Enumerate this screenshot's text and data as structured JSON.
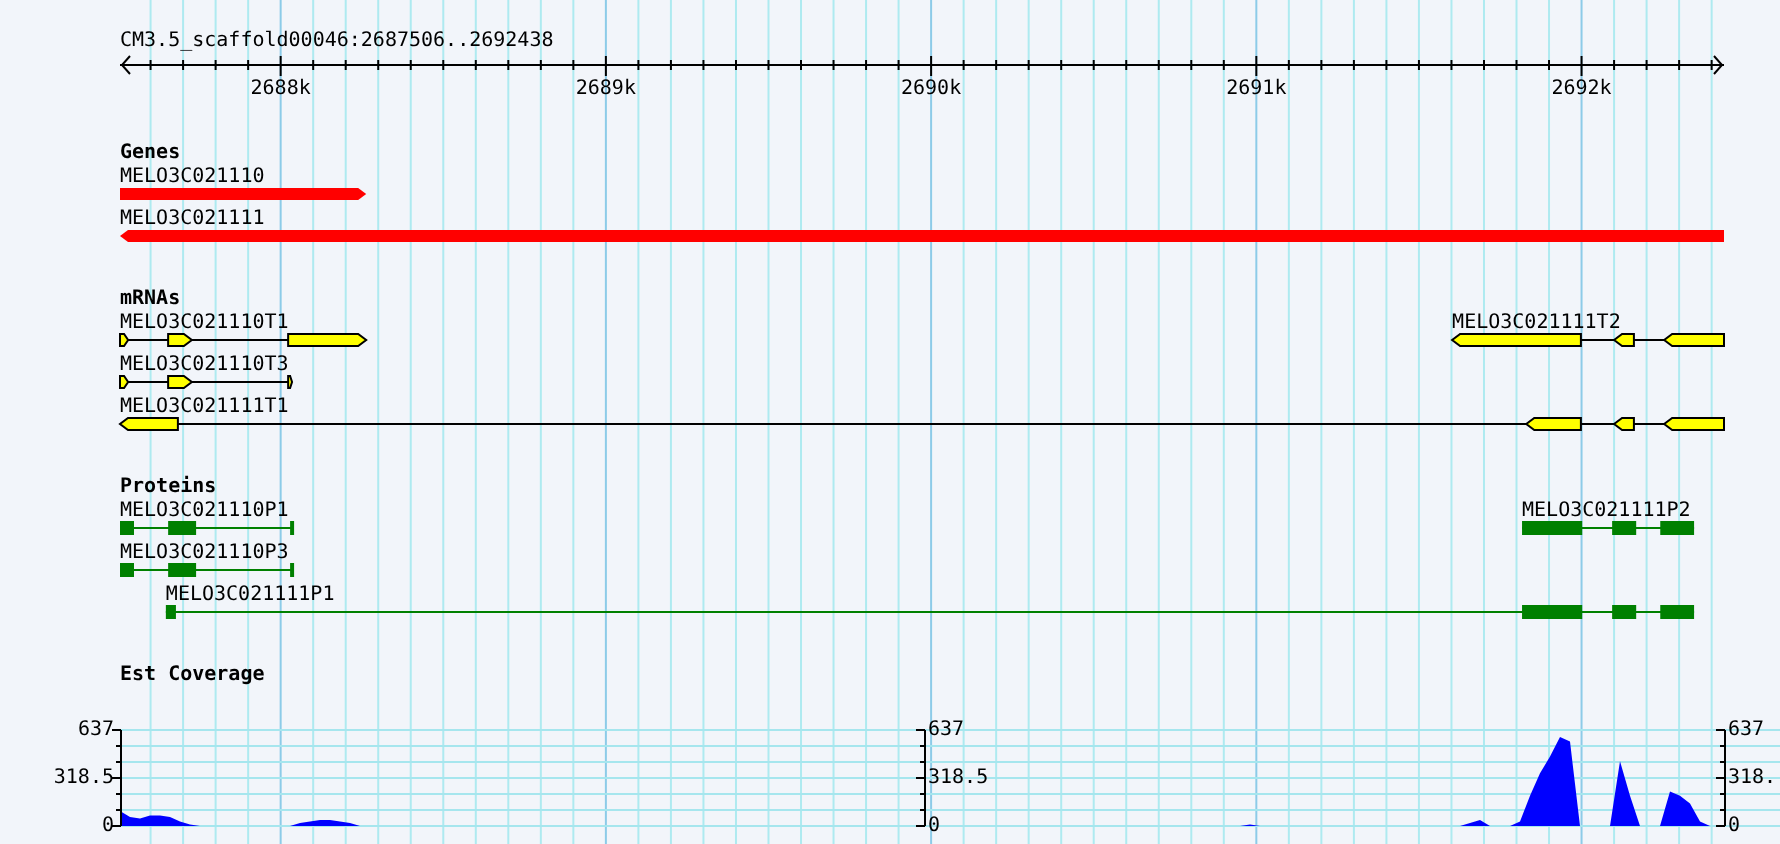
{
  "ruler": {
    "title": "CM3.5_scaffold00046:2687506..2692438",
    "labels": [
      "2688k",
      "2689k",
      "2690k",
      "2691k",
      "2692k"
    ]
  },
  "sections": [
    {
      "title": "Genes",
      "kind": "gene",
      "rows": [
        {
          "features": [
            {
              "label": "MELO3C021110",
              "reverse": false
            }
          ]
        },
        {
          "features": [
            {
              "label": "MELO3C021111",
              "reverse": true
            }
          ]
        }
      ]
    },
    {
      "title": "mRNAs",
      "kind": "mrna",
      "rows": [
        {
          "features": [
            {
              "label": "MELO3C021110T1",
              "reverse": false
            },
            {
              "label": "MELO3C021111T2",
              "reverse": true
            }
          ]
        },
        {
          "features": [
            {
              "label": "MELO3C021110T3",
              "reverse": false
            }
          ]
        },
        {
          "features": [
            {
              "label": "MELO3C021111T1",
              "reverse": true
            }
          ]
        }
      ]
    },
    {
      "title": "Proteins",
      "kind": "protein",
      "rows": [
        {
          "features": [
            {
              "label": "MELO3C021110P1"
            },
            {
              "label": "MELO3C021111P2"
            }
          ]
        },
        {
          "features": [
            {
              "label": "MELO3C021110P3"
            }
          ]
        },
        {
          "features": [
            {
              "label": "MELO3C021111P1"
            }
          ]
        }
      ]
    }
  ],
  "coverage": {
    "title": "Est Coverage",
    "extra_axis_labels": [
      [
        "637",
        "318.5",
        "0"
      ],
      [
        "637",
        "318.",
        "0"
      ]
    ],
    "chart_data": {
      "type": "area",
      "ylim": [
        0,
        637
      ],
      "yticks": [
        0,
        318.5,
        637
      ],
      "categories": [
        null,
        null,
        null,
        null,
        null,
        null,
        null,
        null,
        null,
        null,
        null,
        null,
        null,
        null,
        null,
        null,
        null,
        null,
        null,
        null,
        null,
        null,
        null,
        null,
        null,
        null,
        null,
        null,
        null,
        null,
        null,
        null,
        null,
        null,
        null,
        null,
        null,
        null,
        null,
        null,
        null,
        null,
        null,
        null,
        null,
        null,
        null,
        null,
        null,
        null,
        null,
        null,
        null,
        null,
        null,
        null,
        null,
        null,
        null,
        null,
        null,
        null,
        null,
        null,
        null,
        null,
        null,
        null,
        null,
        null,
        null,
        null,
        null,
        null,
        null,
        null,
        null,
        null,
        null,
        null,
        null,
        null,
        null,
        null,
        null,
        null,
        null,
        null,
        null,
        null,
        null,
        null,
        null,
        null,
        null,
        null,
        null,
        null,
        null,
        null,
        null,
        null,
        null,
        null,
        null,
        null,
        null,
        null,
        null,
        null,
        null,
        null,
        null,
        null,
        null,
        null,
        null,
        null,
        null,
        null,
        null,
        null,
        null,
        null,
        null,
        null,
        null,
        null,
        null,
        null,
        null,
        null,
        null,
        null,
        null,
        null,
        null,
        null,
        null,
        null,
        null,
        null,
        null,
        null,
        null,
        null,
        null,
        null,
        null,
        null,
        null,
        null,
        null,
        null,
        null,
        null,
        null,
        null,
        null,
        null,
        null
      ],
      "series": [
        {
          "color": "#0000ff",
          "values": [
            100,
            60,
            50,
            70,
            70,
            60,
            30,
            10,
            0,
            0,
            0,
            0,
            0,
            0,
            0,
            0,
            0,
            0,
            20,
            30,
            40,
            40,
            30,
            20,
            0,
            0,
            0,
            0,
            0,
            0,
            0,
            0,
            0,
            0,
            0,
            0,
            0,
            0,
            0,
            0,
            0,
            0,
            0,
            0,
            0,
            0,
            0,
            0,
            0,
            0,
            0,
            0,
            0,
            0,
            0,
            0,
            0,
            0,
            0,
            0,
            0,
            0,
            0,
            0,
            0,
            0,
            0,
            0,
            0,
            0,
            0,
            0,
            0,
            0,
            0,
            0,
            0,
            0,
            0,
            0,
            0,
            0,
            0,
            0,
            0,
            0,
            0,
            0,
            0,
            0,
            0,
            0,
            0,
            0,
            0,
            0,
            0,
            0,
            0,
            0,
            0,
            0,
            0,
            0,
            0,
            0,
            0,
            0,
            0,
            0,
            0,
            0,
            0,
            10,
            0,
            0,
            0,
            0,
            0,
            0,
            0,
            0,
            0,
            0,
            0,
            0,
            0,
            0,
            0,
            0,
            0,
            0,
            0,
            0,
            0,
            20,
            40,
            0,
            0,
            0,
            30,
            200,
            350,
            460,
            590,
            560,
            0,
            0,
            0,
            0,
            430,
            200,
            0,
            0,
            0,
            230,
            200,
            150,
            30,
            0,
            0
          ]
        }
      ]
    }
  }
}
